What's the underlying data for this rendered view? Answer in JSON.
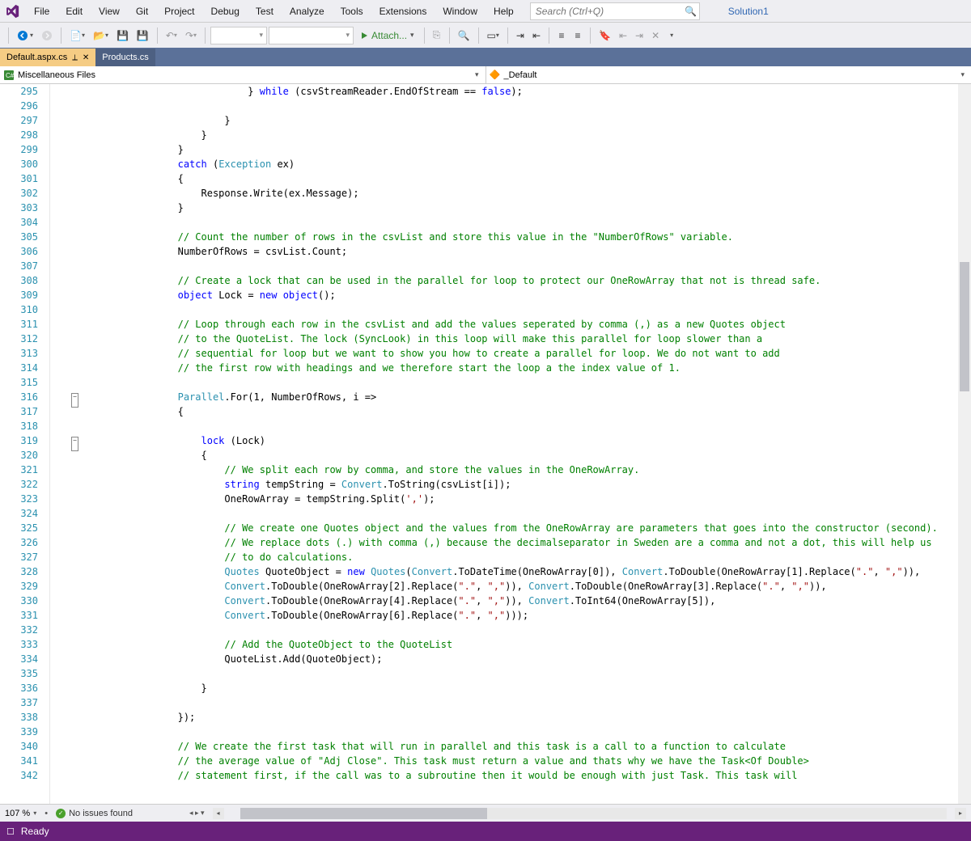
{
  "menu": {
    "items": [
      "File",
      "Edit",
      "View",
      "Git",
      "Project",
      "Debug",
      "Test",
      "Analyze",
      "Tools",
      "Extensions",
      "Window",
      "Help"
    ]
  },
  "search": {
    "placeholder": "Search (Ctrl+Q)"
  },
  "solution": {
    "label": "Solution1"
  },
  "toolbar": {
    "attach_label": "Attach..."
  },
  "tabs": {
    "active": "Default.aspx.cs",
    "inactive": "Products.cs"
  },
  "nav": {
    "scope": "Miscellaneous Files",
    "member": "_Default"
  },
  "gutter": {
    "start": 295,
    "end": 342
  },
  "fold_lines": [
    316,
    319
  ],
  "code": [
    {
      "i": 0,
      "t": [
        {
          "t": "                "
        },
        {
          "t": "} "
        },
        {
          "c": "kw",
          "t": "while"
        },
        {
          "t": " (csvStreamReader.EndOfStream == "
        },
        {
          "c": "kw",
          "t": "false"
        },
        {
          "t": ");"
        }
      ]
    },
    {
      "i": 0,
      "t": []
    },
    {
      "i": 0,
      "t": [
        {
          "t": "            }"
        }
      ]
    },
    {
      "i": 0,
      "t": [
        {
          "t": "        }"
        }
      ]
    },
    {
      "i": 0,
      "t": [
        {
          "t": "    }"
        }
      ]
    },
    {
      "i": 0,
      "t": [
        {
          "t": "    "
        },
        {
          "c": "kw",
          "t": "catch"
        },
        {
          "t": " ("
        },
        {
          "c": "type",
          "t": "Exception"
        },
        {
          "t": " ex)"
        }
      ]
    },
    {
      "i": 0,
      "t": [
        {
          "t": "    {"
        }
      ]
    },
    {
      "i": 0,
      "t": [
        {
          "t": "        Response.Write(ex.Message);"
        }
      ]
    },
    {
      "i": 0,
      "t": [
        {
          "t": "    }"
        }
      ]
    },
    {
      "i": 0,
      "t": []
    },
    {
      "i": 0,
      "t": [
        {
          "t": "    "
        },
        {
          "c": "cm",
          "t": "// Count the number of rows in the csvList and store this value in the \"NumberOfRows\" variable."
        }
      ]
    },
    {
      "i": 0,
      "t": [
        {
          "t": "    NumberOfRows = csvList.Count;"
        }
      ]
    },
    {
      "i": 0,
      "t": []
    },
    {
      "i": 0,
      "t": [
        {
          "t": "    "
        },
        {
          "c": "cm",
          "t": "// Create a lock that can be used in the parallel for loop to protect our OneRowArray that not is thread safe."
        }
      ]
    },
    {
      "i": 0,
      "t": [
        {
          "t": "    "
        },
        {
          "c": "kw",
          "t": "object"
        },
        {
          "t": " Lock = "
        },
        {
          "c": "kw",
          "t": "new"
        },
        {
          "t": " "
        },
        {
          "c": "kw",
          "t": "object"
        },
        {
          "t": "();"
        }
      ]
    },
    {
      "i": 0,
      "t": []
    },
    {
      "i": 0,
      "t": [
        {
          "t": "    "
        },
        {
          "c": "cm",
          "t": "// Loop through each row in the csvList and add the values seperated by comma (,) as a new Quotes object"
        }
      ]
    },
    {
      "i": 0,
      "t": [
        {
          "t": "    "
        },
        {
          "c": "cm",
          "t": "// to the QuoteList. The lock (SyncLook) in this loop will make this parallel for loop slower than a"
        }
      ]
    },
    {
      "i": 0,
      "t": [
        {
          "t": "    "
        },
        {
          "c": "cm",
          "t": "// sequential for loop but we want to show you how to create a parallel for loop. We do not want to add"
        }
      ]
    },
    {
      "i": 0,
      "t": [
        {
          "t": "    "
        },
        {
          "c": "cm",
          "t": "// the first row with headings and we therefore start the loop a the index value of 1."
        }
      ]
    },
    {
      "i": 0,
      "t": []
    },
    {
      "i": 0,
      "t": [
        {
          "t": "    "
        },
        {
          "c": "type",
          "t": "Parallel"
        },
        {
          "t": ".For(1, NumberOfRows, i =>"
        }
      ]
    },
    {
      "i": 0,
      "t": [
        {
          "t": "    {"
        }
      ]
    },
    {
      "i": 0,
      "t": []
    },
    {
      "i": 0,
      "t": [
        {
          "t": "        "
        },
        {
          "c": "kw",
          "t": "lock"
        },
        {
          "t": " (Lock)"
        }
      ]
    },
    {
      "i": 0,
      "t": [
        {
          "t": "        {"
        }
      ]
    },
    {
      "i": 0,
      "t": [
        {
          "t": "            "
        },
        {
          "c": "cm",
          "t": "// We split each row by comma, and store the values in the OneRowArray."
        }
      ]
    },
    {
      "i": 0,
      "t": [
        {
          "t": "            "
        },
        {
          "c": "kw",
          "t": "string"
        },
        {
          "t": " tempString = "
        },
        {
          "c": "type",
          "t": "Convert"
        },
        {
          "t": ".ToString(csvList[i]);"
        }
      ]
    },
    {
      "i": 0,
      "t": [
        {
          "t": "            OneRowArray = tempString.Split("
        },
        {
          "c": "st",
          "t": "','"
        },
        {
          "t": ");"
        }
      ]
    },
    {
      "i": 0,
      "t": []
    },
    {
      "i": 0,
      "t": [
        {
          "t": "            "
        },
        {
          "c": "cm",
          "t": "// We create one Quotes object and the values from the OneRowArray are parameters that goes into the constructor (second)."
        }
      ]
    },
    {
      "i": 0,
      "t": [
        {
          "t": "            "
        },
        {
          "c": "cm",
          "t": "// We replace dots (.) with comma (,) because the decimalseparator in Sweden are a comma and not a dot, this will help us"
        }
      ]
    },
    {
      "i": 0,
      "t": [
        {
          "t": "            "
        },
        {
          "c": "cm",
          "t": "// to do calculations."
        }
      ]
    },
    {
      "i": 0,
      "t": [
        {
          "t": "            "
        },
        {
          "c": "type",
          "t": "Quotes"
        },
        {
          "t": " QuoteObject = "
        },
        {
          "c": "kw",
          "t": "new"
        },
        {
          "t": " "
        },
        {
          "c": "type",
          "t": "Quotes"
        },
        {
          "t": "("
        },
        {
          "c": "type",
          "t": "Convert"
        },
        {
          "t": ".ToDateTime(OneRowArray[0]), "
        },
        {
          "c": "type",
          "t": "Convert"
        },
        {
          "t": ".ToDouble(OneRowArray[1].Replace("
        },
        {
          "c": "st",
          "t": "\".\""
        },
        {
          "t": ", "
        },
        {
          "c": "st",
          "t": "\",\""
        },
        {
          "t": ")),"
        }
      ]
    },
    {
      "i": 0,
      "t": [
        {
          "t": "            "
        },
        {
          "c": "type",
          "t": "Convert"
        },
        {
          "t": ".ToDouble(OneRowArray[2].Replace("
        },
        {
          "c": "st",
          "t": "\".\""
        },
        {
          "t": ", "
        },
        {
          "c": "st",
          "t": "\",\""
        },
        {
          "t": ")), "
        },
        {
          "c": "type",
          "t": "Convert"
        },
        {
          "t": ".ToDouble(OneRowArray[3].Replace("
        },
        {
          "c": "st",
          "t": "\".\""
        },
        {
          "t": ", "
        },
        {
          "c": "st",
          "t": "\",\""
        },
        {
          "t": ")),"
        }
      ]
    },
    {
      "i": 0,
      "t": [
        {
          "t": "            "
        },
        {
          "c": "type",
          "t": "Convert"
        },
        {
          "t": ".ToDouble(OneRowArray[4].Replace("
        },
        {
          "c": "st",
          "t": "\".\""
        },
        {
          "t": ", "
        },
        {
          "c": "st",
          "t": "\",\""
        },
        {
          "t": ")), "
        },
        {
          "c": "type",
          "t": "Convert"
        },
        {
          "t": ".ToInt64(OneRowArray[5]),"
        }
      ]
    },
    {
      "i": 0,
      "t": [
        {
          "t": "            "
        },
        {
          "c": "type",
          "t": "Convert"
        },
        {
          "t": ".ToDouble(OneRowArray[6].Replace("
        },
        {
          "c": "st",
          "t": "\".\""
        },
        {
          "t": ", "
        },
        {
          "c": "st",
          "t": "\",\""
        },
        {
          "t": ")));"
        }
      ]
    },
    {
      "i": 0,
      "t": []
    },
    {
      "i": 0,
      "t": [
        {
          "t": "            "
        },
        {
          "c": "cm",
          "t": "// Add the QuoteObject to the QuoteList"
        }
      ]
    },
    {
      "i": 0,
      "t": [
        {
          "t": "            QuoteList.Add(QuoteObject);"
        }
      ]
    },
    {
      "i": 0,
      "t": []
    },
    {
      "i": 0,
      "t": [
        {
          "t": "        }"
        }
      ]
    },
    {
      "i": 0,
      "t": []
    },
    {
      "i": 0,
      "t": [
        {
          "t": "    });"
        }
      ]
    },
    {
      "i": 0,
      "t": []
    },
    {
      "i": 0,
      "t": [
        {
          "t": "    "
        },
        {
          "c": "cm",
          "t": "// We create the first task that will run in parallel and this task is a call to a function to calculate"
        }
      ]
    },
    {
      "i": 0,
      "t": [
        {
          "t": "    "
        },
        {
          "c": "cm",
          "t": "// the average value of \"Adj Close\". This task must return a value and thats why we have the Task<Of Double>"
        }
      ]
    },
    {
      "i": 0,
      "t": [
        {
          "t": "    "
        },
        {
          "c": "cm",
          "t": "// statement first, if the call was to a subroutine then it would be enough with just Task. This task will"
        }
      ]
    }
  ],
  "footer": {
    "zoom": "107 %",
    "issues": "No issues found"
  },
  "status": {
    "text": "Ready"
  }
}
